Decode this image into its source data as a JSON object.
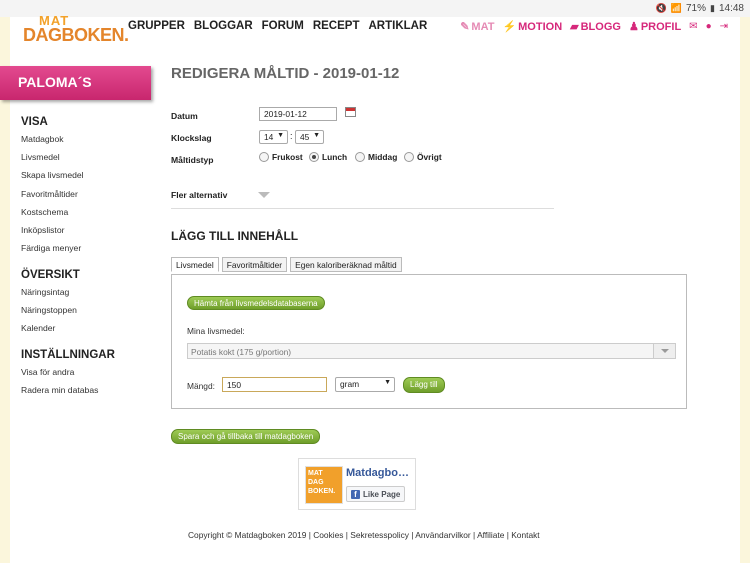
{
  "statusbar": {
    "battery": "71%",
    "time": "14:48"
  },
  "header": {
    "logo_top": "MAT",
    "logo_main": "DAGBOKEN.",
    "nav": [
      "GRUPPER",
      "BLOGGAR",
      "FORUM",
      "RECEPT",
      "ARTIKLAR"
    ],
    "right_nav": {
      "mat": "MAT",
      "motion": "MOTION",
      "blogg": "BLOGG",
      "profil": "PROFIL"
    }
  },
  "sidebar": {
    "banner": "PALOMA´S",
    "sections": [
      {
        "title": "VISA",
        "items": [
          "Matdagbok",
          "Livsmedel",
          "Skapa livsmedel",
          "Favoritmåltider",
          "Kostschema",
          "Inköpslistor",
          "Färdiga menyer"
        ]
      },
      {
        "title": "ÖVERSIKT",
        "items": [
          "Näringsintag",
          "Näringstoppen",
          "Kalender"
        ]
      },
      {
        "title": "INSTÄLLNINGAR",
        "items": [
          "Visa för andra",
          "Radera min databas"
        ]
      }
    ]
  },
  "main": {
    "title": "REDIGERA MÅLTID - 2019-01-12",
    "date_label": "Datum",
    "date_value": "2019-01-12",
    "time_label": "Klockslag",
    "hour": "14",
    "minute": "45",
    "colon": ":",
    "meal_type_label": "Måltidstyp",
    "meal_types": [
      "Frukost",
      "Lunch",
      "Middag",
      "Övrigt"
    ],
    "more_options": "Fler alternativ",
    "add_content_title": "LÄGG TILL INNEHÅLL",
    "tabs": [
      "Livsmedel",
      "Favoritmåltider",
      "Egen kaloriberäknad måltid"
    ],
    "fetch_button": "Hämta från livsmedelsdatabaserna",
    "my_foods_label": "Mina livsmedel:",
    "selected_food": "Potatis kokt (175 g/portion)",
    "amount_label": "Mängd:",
    "amount_value": "150",
    "unit": "gram",
    "add_button": "Lägg till",
    "save_button": "Spara och gå tillbaka till matdagboken"
  },
  "facebook": {
    "logo_lines": [
      "MAT",
      "DAG",
      "BOKEN."
    ],
    "page_name": "Matdagbo…",
    "like": "Like Page"
  },
  "footer": "Copyright © Matdagboken 2019 | Cookies | Sekretesspolicy | Användarvilkor | Affiliate | Kontakt"
}
